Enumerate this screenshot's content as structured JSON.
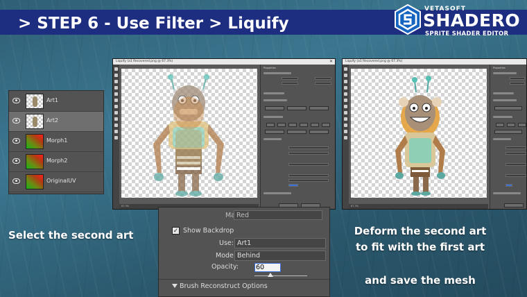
{
  "header": {
    "step_title": "> STEP 6 - Use Filter > Liquify",
    "brand": "VETASOFT",
    "product": "SHADERO",
    "tagline": "SPRITE SHADER EDITOR"
  },
  "layers_panel": {
    "layers": [
      {
        "name": "Art1",
        "thumb": "art",
        "selected": false
      },
      {
        "name": "Art2",
        "thumb": "art",
        "selected": true
      },
      {
        "name": "Morph1",
        "thumb": "gradient",
        "selected": false
      },
      {
        "name": "Morph2",
        "thumb": "gradient",
        "selected": false
      },
      {
        "name": "OriginalUV",
        "thumb": "gradient",
        "selected": false
      }
    ]
  },
  "liquify_windows": [
    {
      "title": "Liquify (a1 Recovered.png @ 67.3%)",
      "status": "67.3%"
    },
    {
      "title": "Liquify (a1 Recovered.png @ 67.3%)",
      "status": "67.3%"
    }
  ],
  "options_zoom": {
    "mask_color_label": "Mask Color:",
    "mask_color_value": "Red",
    "show_backdrop_label": "Show Backdrop",
    "show_backdrop_checked": true,
    "use_label": "Use:",
    "use_value": "Art1",
    "mode_label": "Mode:",
    "mode_value": "Behind",
    "opacity_label": "Opacity:",
    "opacity_value": "60",
    "opacity_level": 0.3,
    "section_label": "Brush Reconstruct Options"
  },
  "captions": {
    "left": "Select the second art",
    "right_line1": "Deform the second art",
    "right_line2": "to fit with the first art",
    "right_line3": "and save the mesh"
  },
  "colors": {
    "banner": "#1d2d80",
    "logo": "#1565c0",
    "background": "#3b7790"
  }
}
